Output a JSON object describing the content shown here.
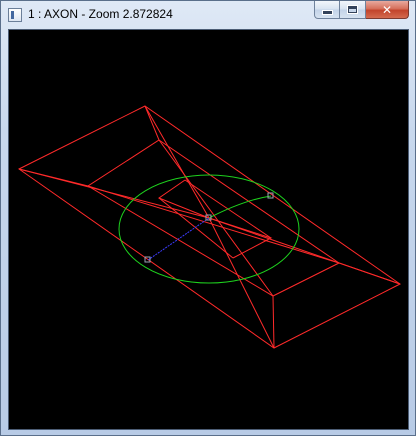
{
  "window": {
    "title": "1 : AXON - Zoom 2.872824",
    "controls": {
      "minimize_icon": "minimize-icon",
      "maximize_icon": "maximize-icon",
      "close_icon": "close-icon",
      "close_glyph": "✕"
    }
  },
  "viewport": {
    "background": "#000000",
    "colors": {
      "frame": "#ff2a2a",
      "ellipse": "#1ed21e",
      "segment": "#3c3cff",
      "handle": "#9aa4b4"
    }
  }
}
